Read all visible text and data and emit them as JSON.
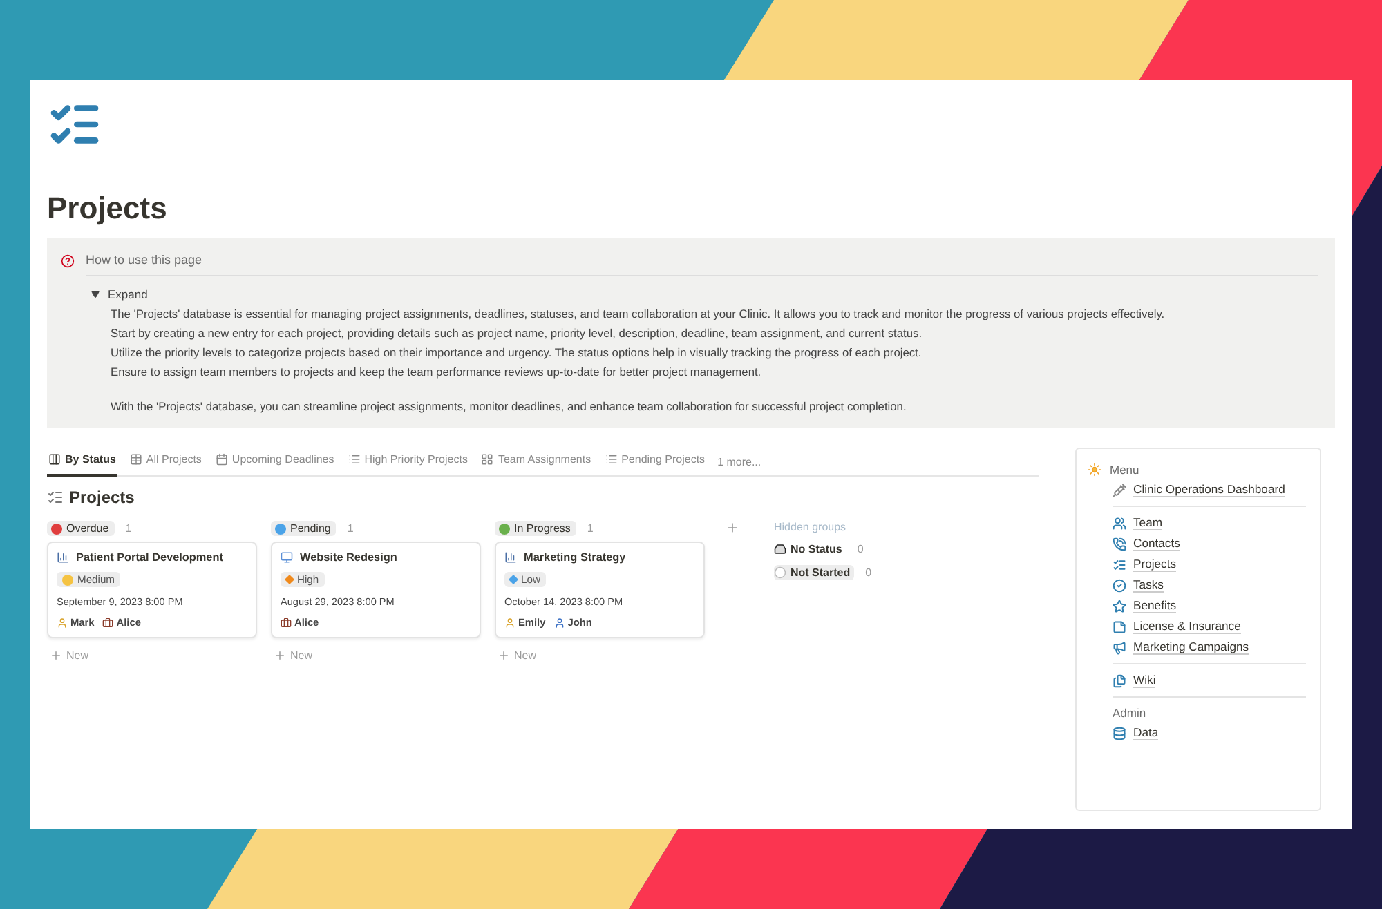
{
  "page": {
    "title": "Projects"
  },
  "callout": {
    "title": "How to use this page",
    "toggle": {
      "label": "Expand",
      "expanded": true
    },
    "paragraphs": [
      "The 'Projects' database is essential for managing project assignments, deadlines, statuses, and team collaboration at your Clinic. It allows you to track and monitor the progress of various projects effectively.",
      "Start by creating a new entry for each project, providing details such as project name, priority level, description, deadline, team assignment, and current status.",
      "Utilize the priority levels to categorize projects based on their importance and urgency. The status options help in visually tracking the progress of each project.",
      "Ensure to assign team members to projects and keep the team performance reviews up-to-date for better project management.",
      "With the 'Projects' database, you can streamline project assignments, monitor deadlines, and enhance team collaboration for successful project completion."
    ]
  },
  "views": [
    {
      "label": "By Status",
      "kind": "board",
      "selected": true
    },
    {
      "label": "All Projects",
      "kind": "table",
      "selected": false
    },
    {
      "label": "Upcoming Deadlines",
      "kind": "calendar",
      "selected": false
    },
    {
      "label": "High Priority Projects",
      "kind": "list",
      "selected": false
    },
    {
      "label": "Team Assignments",
      "kind": "gallery",
      "selected": false
    },
    {
      "label": "Pending Projects",
      "kind": "list",
      "selected": false
    }
  ],
  "more_views": "1 more...",
  "board": {
    "title": "Projects",
    "columns": [
      {
        "status": "Overdue",
        "color": "#e03e3e",
        "count": "1",
        "new_label": "New",
        "cards": [
          {
            "title": "Patient Portal Development",
            "kind": "chart",
            "priority": {
              "label": "Medium",
              "kind": "circle",
              "color": "#f5c342"
            },
            "date": "September 9, 2023 8:00 PM",
            "assignees": [
              {
                "name": "Mark",
                "kind": "person"
              },
              {
                "name": "Alice",
                "kind": "briefcase"
              }
            ]
          }
        ]
      },
      {
        "status": "Pending",
        "color": "#4ba3e8",
        "count": "1",
        "new_label": "New",
        "cards": [
          {
            "title": "Website Redesign",
            "kind": "monitor",
            "priority": {
              "label": "High",
              "kind": "diamond",
              "color": "#f08a1c"
            },
            "date": "August 29, 2023 8:00 PM",
            "assignees": [
              {
                "name": "Alice",
                "kind": "briefcase"
              }
            ]
          }
        ]
      },
      {
        "status": "In Progress",
        "color": "#6ab04c",
        "count": "1",
        "new_label": "New",
        "cards": [
          {
            "title": "Marketing Strategy",
            "kind": "chart",
            "priority": {
              "label": "Low",
              "kind": "diamond",
              "color": "#4ba3e8"
            },
            "date": "October 14, 2023 8:00 PM",
            "assignees": [
              {
                "name": "Emily",
                "kind": "person"
              },
              {
                "name": "John",
                "kind": "person2"
              }
            ]
          }
        ]
      }
    ],
    "hidden_groups": {
      "label": "Hidden groups",
      "groups": [
        {
          "label": "No Status",
          "count": "0",
          "kind": "inbox"
        },
        {
          "label": "Not Started",
          "count": "0",
          "kind": "circle"
        }
      ]
    }
  },
  "sidebar": {
    "heading": "Menu",
    "groups": [
      {
        "items": [
          {
            "label": "Clinic Operations Dashboard",
            "kind": "syringe"
          }
        ]
      },
      {
        "items": [
          {
            "label": "Team",
            "kind": "users"
          },
          {
            "label": "Contacts",
            "kind": "phone"
          },
          {
            "label": "Projects",
            "kind": "checklist"
          },
          {
            "label": "Tasks",
            "kind": "check"
          },
          {
            "label": "Benefits",
            "kind": "star"
          },
          {
            "label": "License & Insurance",
            "kind": "note"
          },
          {
            "label": "Marketing Campaigns",
            "kind": "megaphone"
          }
        ]
      },
      {
        "items": [
          {
            "label": "Wiki",
            "kind": "files"
          }
        ]
      },
      {
        "heading": "Admin",
        "items": [
          {
            "label": "Data",
            "kind": "database"
          }
        ]
      }
    ]
  }
}
